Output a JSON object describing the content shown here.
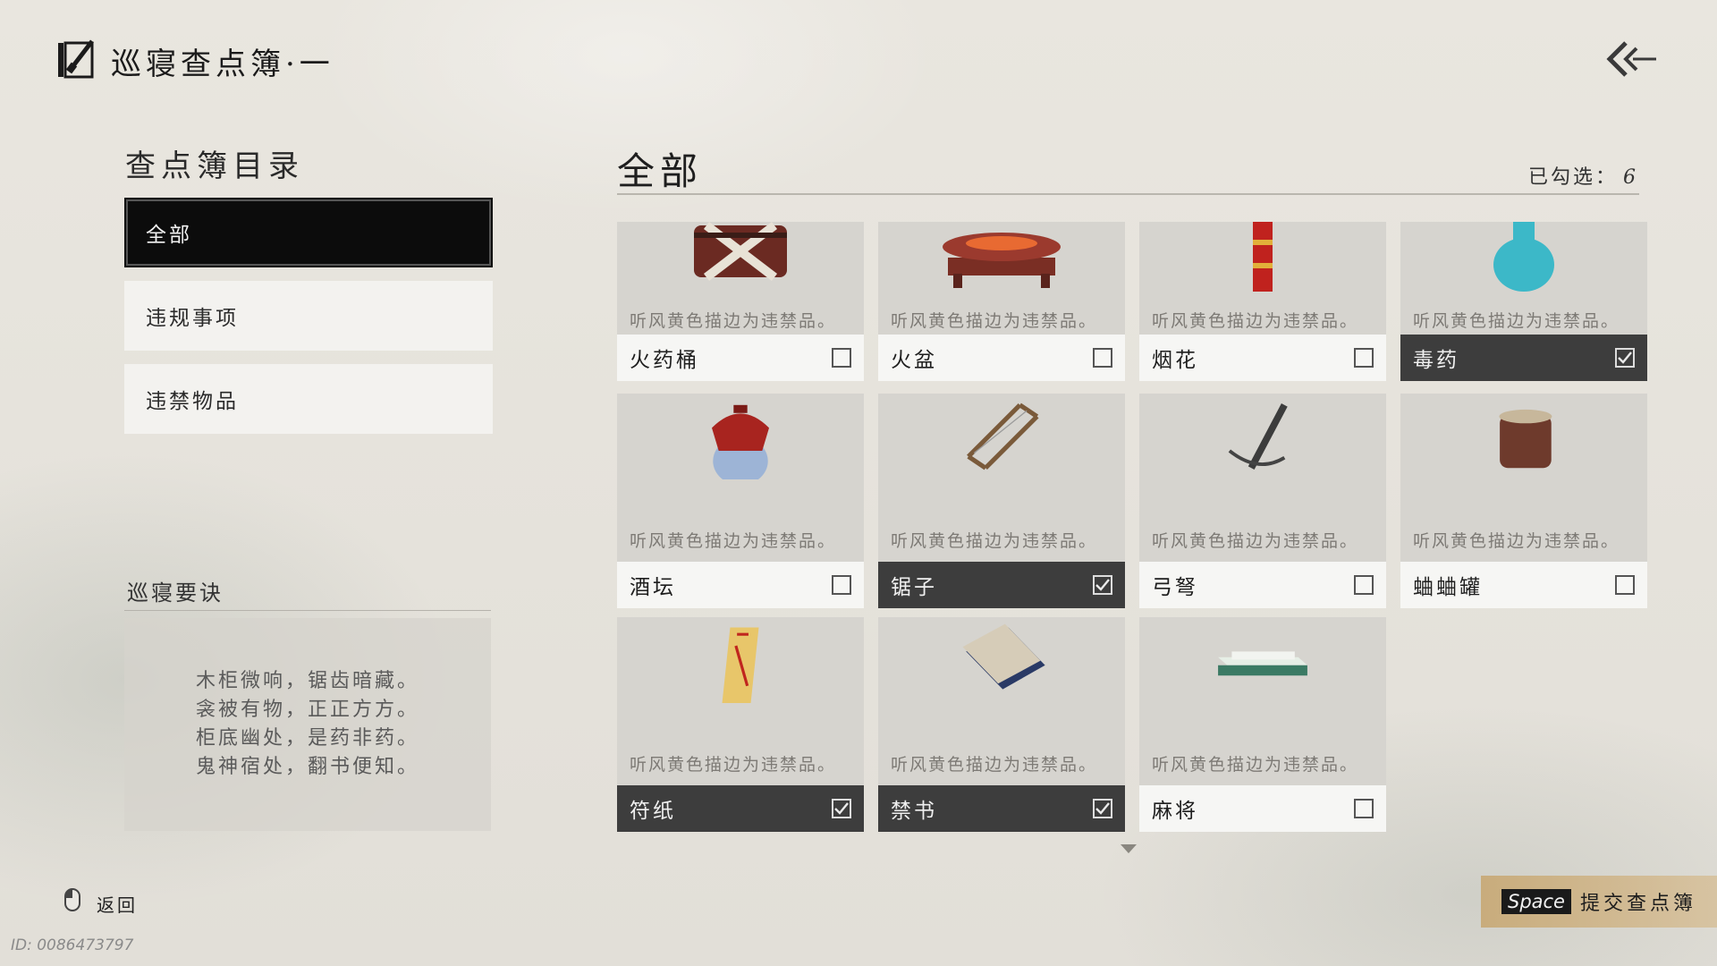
{
  "header": {
    "title": "巡寝查点簿·一",
    "back_icon": "double-chevron-left-icon"
  },
  "directory": {
    "title": "查点簿目录",
    "items": [
      {
        "label": "全部",
        "active": true
      },
      {
        "label": "违规事项",
        "active": false
      },
      {
        "label": "违禁物品",
        "active": false
      }
    ]
  },
  "tips": {
    "title": "巡寝要诀",
    "lines": [
      "木柜微响，锯齿暗藏。",
      "衾被有物，正正方方。",
      "柜底幽处，是药非药。",
      "鬼神宿处，翻书便知。"
    ]
  },
  "category": {
    "title": "全部",
    "checked_label": "已勾选：",
    "checked_count": "6"
  },
  "items": [
    {
      "name": "火药桶",
      "hint": "听风黄色描边为违禁品。",
      "checked": false,
      "icon": "powder-keg-icon"
    },
    {
      "name": "火盆",
      "hint": "听风黄色描边为违禁品。",
      "checked": false,
      "icon": "brazier-icon"
    },
    {
      "name": "烟花",
      "hint": "听风黄色描边为违禁品。",
      "checked": false,
      "icon": "firework-icon"
    },
    {
      "name": "毒药",
      "hint": "听风黄色描边为违禁品。",
      "checked": true,
      "icon": "poison-vase-icon"
    },
    {
      "name": "酒坛",
      "hint": "听风黄色描边为违禁品。",
      "checked": false,
      "icon": "wine-jar-icon"
    },
    {
      "name": "锯子",
      "hint": "听风黄色描边为违禁品。",
      "checked": true,
      "icon": "saw-icon"
    },
    {
      "name": "弓弩",
      "hint": "听风黄色描边为违禁品。",
      "checked": false,
      "icon": "crossbow-icon"
    },
    {
      "name": "蛐蛐罐",
      "hint": "听风黄色描边为违禁品。",
      "checked": false,
      "icon": "cricket-pot-icon"
    },
    {
      "name": "符纸",
      "hint": "听风黄色描边为违禁品。",
      "checked": true,
      "icon": "talisman-icon"
    },
    {
      "name": "禁书",
      "hint": "听风黄色描边为违禁品。",
      "checked": true,
      "icon": "forbidden-book-icon"
    },
    {
      "name": "麻将",
      "hint": "听风黄色描边为违禁品。",
      "checked": false,
      "icon": "mahjong-icon"
    }
  ],
  "footer": {
    "return_label": "返回",
    "submit_key": "Space",
    "submit_label": "提交查点簿",
    "id_text": "ID: 0086473797"
  },
  "colors": {
    "background": "#e6e3dc",
    "active_item": "#0c0c0c",
    "checked_bar": "#3d3d3d",
    "submit_gold": "#c8aa78"
  }
}
